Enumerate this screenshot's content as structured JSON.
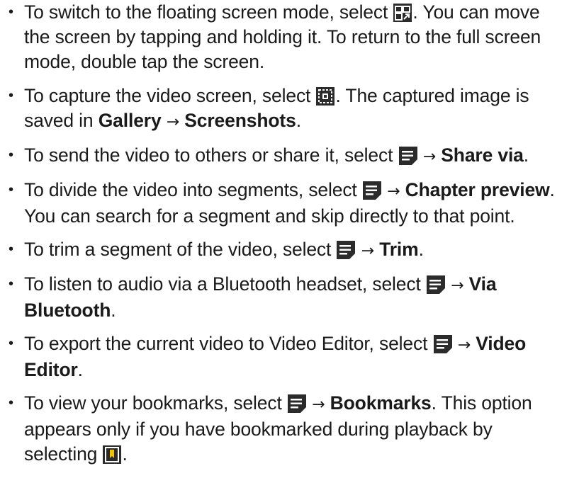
{
  "bullet_char": "•",
  "arrow": "→",
  "items": [
    {
      "before": "To switch to the floating screen mode, select ",
      "icon": "floating-screen-icon",
      "after": ". You can move the screen by tapping and holding it. To return to the full screen mode, double tap the screen."
    },
    {
      "before": "To capture the video screen, select ",
      "icon": "capture-icon",
      "after": ". The captured image is saved in ",
      "b1": "Gallery",
      "b2": "Screenshots",
      "end": "."
    },
    {
      "before": "To send the video to others or share it, select ",
      "icon": "menu-icon",
      "b1": "Share via",
      "end": "."
    },
    {
      "before": "To divide the video into segments, select ",
      "icon": "menu-icon",
      "b1": "Chapter preview",
      "after": ". You can search for a segment and skip directly to that point."
    },
    {
      "before": "To trim a segment of the video, select ",
      "icon": "menu-icon",
      "b1": "Trim",
      "end": "."
    },
    {
      "before": "To listen to audio via a Bluetooth headset, select ",
      "icon": "menu-icon",
      "b1": "Via Bluetooth",
      "end": "."
    },
    {
      "before": "To export the current video to Video Editor, select ",
      "icon": "menu-icon",
      "b1": "Video Editor",
      "end": "."
    },
    {
      "before": "To view your bookmarks, select ",
      "icon": "menu-icon",
      "b1": "Bookmarks",
      "after": ". This option appears only if you have bookmarked during playback by selecting ",
      "icon2": "bookmark-icon",
      "end": "."
    }
  ],
  "colors": {
    "text": "#1a1a1a",
    "icon_dark": "#2b2b2b",
    "icon_accent": "#f2c200",
    "icon_bg": "#ffffff"
  }
}
